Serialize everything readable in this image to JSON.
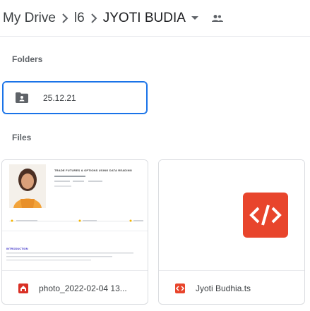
{
  "breadcrumb": {
    "root": "My Drive",
    "level1": "l6",
    "current": "JYOTI BUDIA"
  },
  "sections": {
    "folders_label": "Folders",
    "files_label": "Files"
  },
  "folders": [
    {
      "name": "25.12.21",
      "icon": "folder-person-icon"
    }
  ],
  "files": [
    {
      "name": "photo_2022-02-04 13...",
      "icon": "pdf-icon",
      "icon_color": "#d93025",
      "thumbnail": "document-preview"
    },
    {
      "name": "Jyoti Budhia.ts",
      "icon": "code-file-icon",
      "icon_color": "#e8452c",
      "thumbnail": "code-badge"
    }
  ],
  "thumbnail_text": {
    "doc_heading": "TRADE FUTURES & OPTIONS USING DATA READING",
    "doc_section": "INTRODUCTION"
  },
  "colors": {
    "accent": "#1a73e8",
    "code_badge": "#e8452c",
    "pdf_red": "#d93025"
  }
}
